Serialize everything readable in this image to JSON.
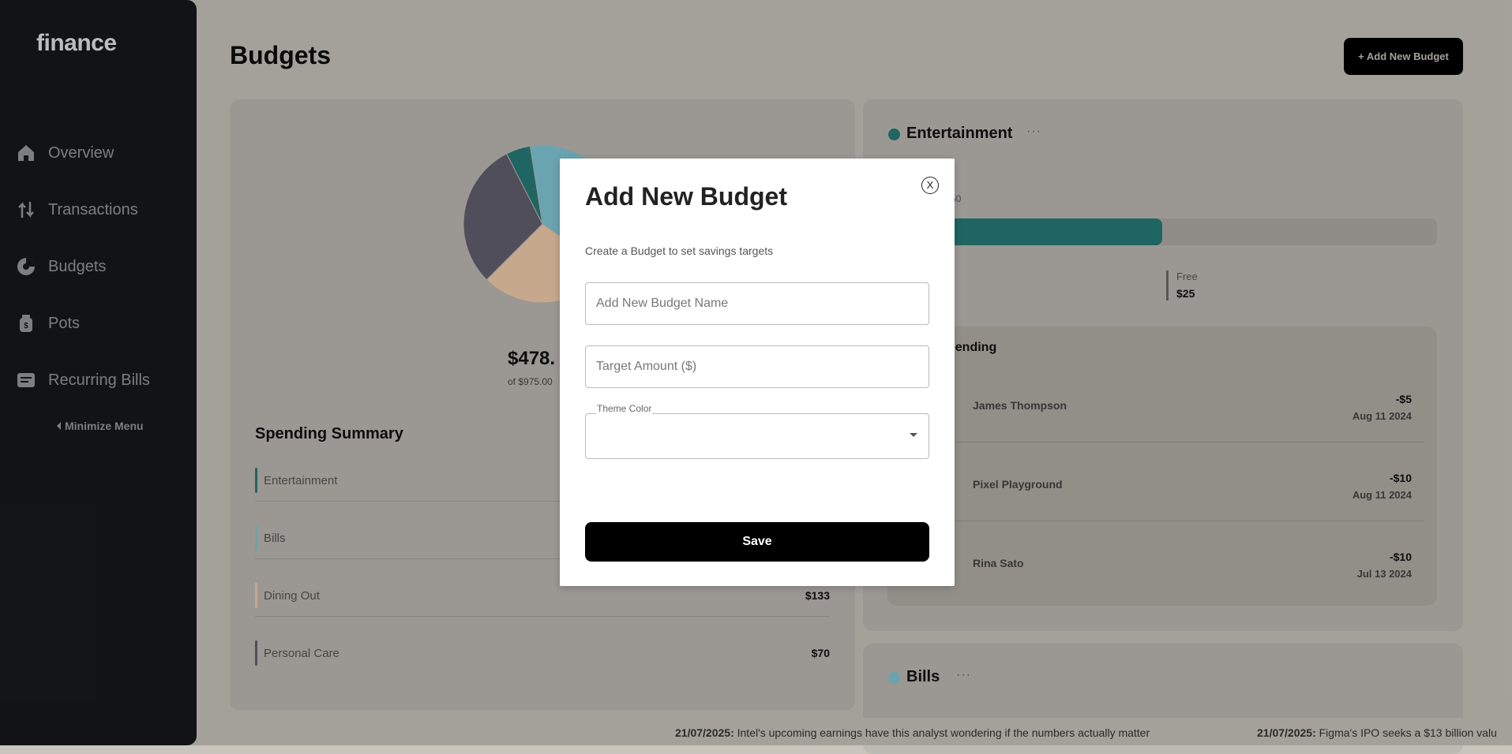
{
  "app": {
    "logo": "finance"
  },
  "sidebar": {
    "items": [
      {
        "label": "Overview",
        "icon": "home-icon"
      },
      {
        "label": "Transactions",
        "icon": "arrows-icon"
      },
      {
        "label": "Budgets",
        "icon": "pie-icon"
      },
      {
        "label": "Pots",
        "icon": "jar-icon"
      },
      {
        "label": "Recurring Bills",
        "icon": "receipt-icon"
      }
    ],
    "minimize_label": "Minimize Menu"
  },
  "header": {
    "title": "Budgets",
    "add_button": "+ Add New Budget"
  },
  "chart_data": {
    "type": "pie",
    "slices": [
      {
        "name": "Entertainment",
        "color": "#277c78"
      },
      {
        "name": "Bills",
        "color": "#82c9d7"
      },
      {
        "name": "Dining Out",
        "color": "#f2cdac"
      },
      {
        "name": "Personal Care",
        "color": "#626070"
      }
    ],
    "total_partial": "$478.",
    "limit_partial": "of $975.00"
  },
  "summary": {
    "title": "Spending Summary",
    "rows": [
      {
        "name": "Entertainment",
        "amount": "",
        "color": "#277c78"
      },
      {
        "name": "Bills",
        "amount": "",
        "color": "#82c9d7"
      },
      {
        "name": "Dining Out",
        "amount": "$133",
        "color": "#f2cdac"
      },
      {
        "name": "Personal Care",
        "amount": "$70",
        "color": "#626070"
      }
    ]
  },
  "entertainment": {
    "title": "Entertainment",
    "max_partial": "50",
    "progress": 0.5,
    "free_label": "Free",
    "free_value": "$25",
    "latest_title_partial": "pending",
    "transactions": [
      {
        "name": "James Thompson",
        "amount": "-$5",
        "date": "Aug 11 2024"
      },
      {
        "name": "Pixel Playground",
        "amount": "-$10",
        "date": "Aug 11 2024"
      },
      {
        "name": "Rina Sato",
        "amount": "-$10",
        "date": "Jul 13 2024"
      }
    ]
  },
  "bills": {
    "title": "Bills"
  },
  "ticker": [
    {
      "date": "21/07/2025:",
      "text": "Intel's upcoming earnings have this analyst wondering if the numbers actually matter"
    },
    {
      "date": "21/07/2025:",
      "text": "Figma's IPO seeks a $13 billion valu"
    }
  ],
  "modal": {
    "title": "Add New Budget",
    "close": "X",
    "description": "Create a Budget to set savings targets",
    "name_placeholder": "Add New Budget Name",
    "target_placeholder": "Target Amount ($)",
    "theme_label": "Theme Color",
    "theme_value": "",
    "save": "Save"
  }
}
